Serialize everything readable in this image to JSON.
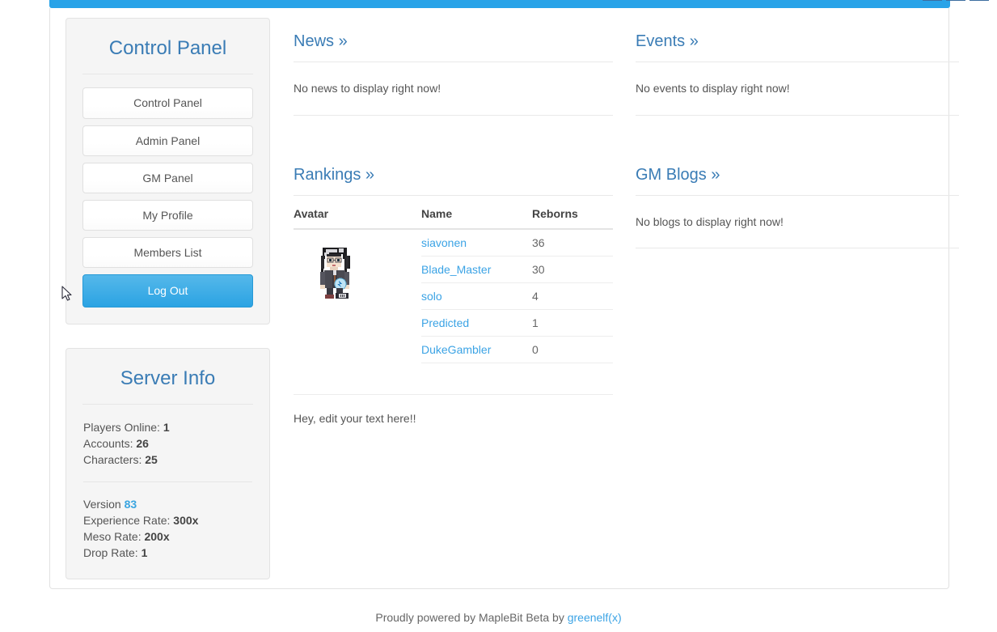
{
  "topbar": {
    "color": "#29a3e8",
    "nav_items": [
      "",
      "",
      ""
    ]
  },
  "sidebar": {
    "control_panel": {
      "title": "Control Panel",
      "buttons": [
        {
          "label": "Control Panel",
          "primary": false
        },
        {
          "label": "Admin Panel",
          "primary": false
        },
        {
          "label": "GM Panel",
          "primary": false
        },
        {
          "label": "My Profile",
          "primary": false
        },
        {
          "label": "Members List",
          "primary": false
        },
        {
          "label": "Log Out",
          "primary": true
        }
      ]
    },
    "server_info": {
      "title": "Server Info",
      "stats": [
        {
          "label": "Players Online:",
          "value": "1"
        },
        {
          "label": "Accounts:",
          "value": "26"
        },
        {
          "label": "Characters:",
          "value": "25"
        }
      ],
      "version_label": "Version",
      "version_value": "83",
      "rates": [
        {
          "label": "Experience Rate:",
          "value": "300x"
        },
        {
          "label": "Meso Rate:",
          "value": "200x"
        },
        {
          "label": "Drop Rate:",
          "value": "1"
        }
      ]
    }
  },
  "main": {
    "news": {
      "heading": "News »",
      "empty_text": "No news to display right now!"
    },
    "rankings": {
      "heading": "Rankings »",
      "columns": [
        "Avatar",
        "Name",
        "Reborns"
      ],
      "rows": [
        {
          "name": "siavonen",
          "reborns": "36"
        },
        {
          "name": "Blade_Master",
          "reborns": "30"
        },
        {
          "name": "solo",
          "reborns": "4"
        },
        {
          "name": "Predicted",
          "reborns": "1"
        },
        {
          "name": "DukeGambler",
          "reborns": "0"
        }
      ]
    },
    "editable": {
      "text": "Hey, edit your text here!!"
    }
  },
  "aside": {
    "events": {
      "heading": "Events »",
      "empty_text": "No events to display right now!"
    },
    "gm_blogs": {
      "heading": "GM Blogs »",
      "empty_text": "No blogs to display right now!"
    }
  },
  "footer": {
    "text": "Proudly powered by MapleBit Beta by",
    "link": "greenelf(x)"
  },
  "colors": {
    "accent_blue": "#3ba3e5",
    "heading_blue": "#3a7cb5",
    "topbar_blue": "#29a3e8",
    "panel_bg": "#f5f5f5"
  }
}
